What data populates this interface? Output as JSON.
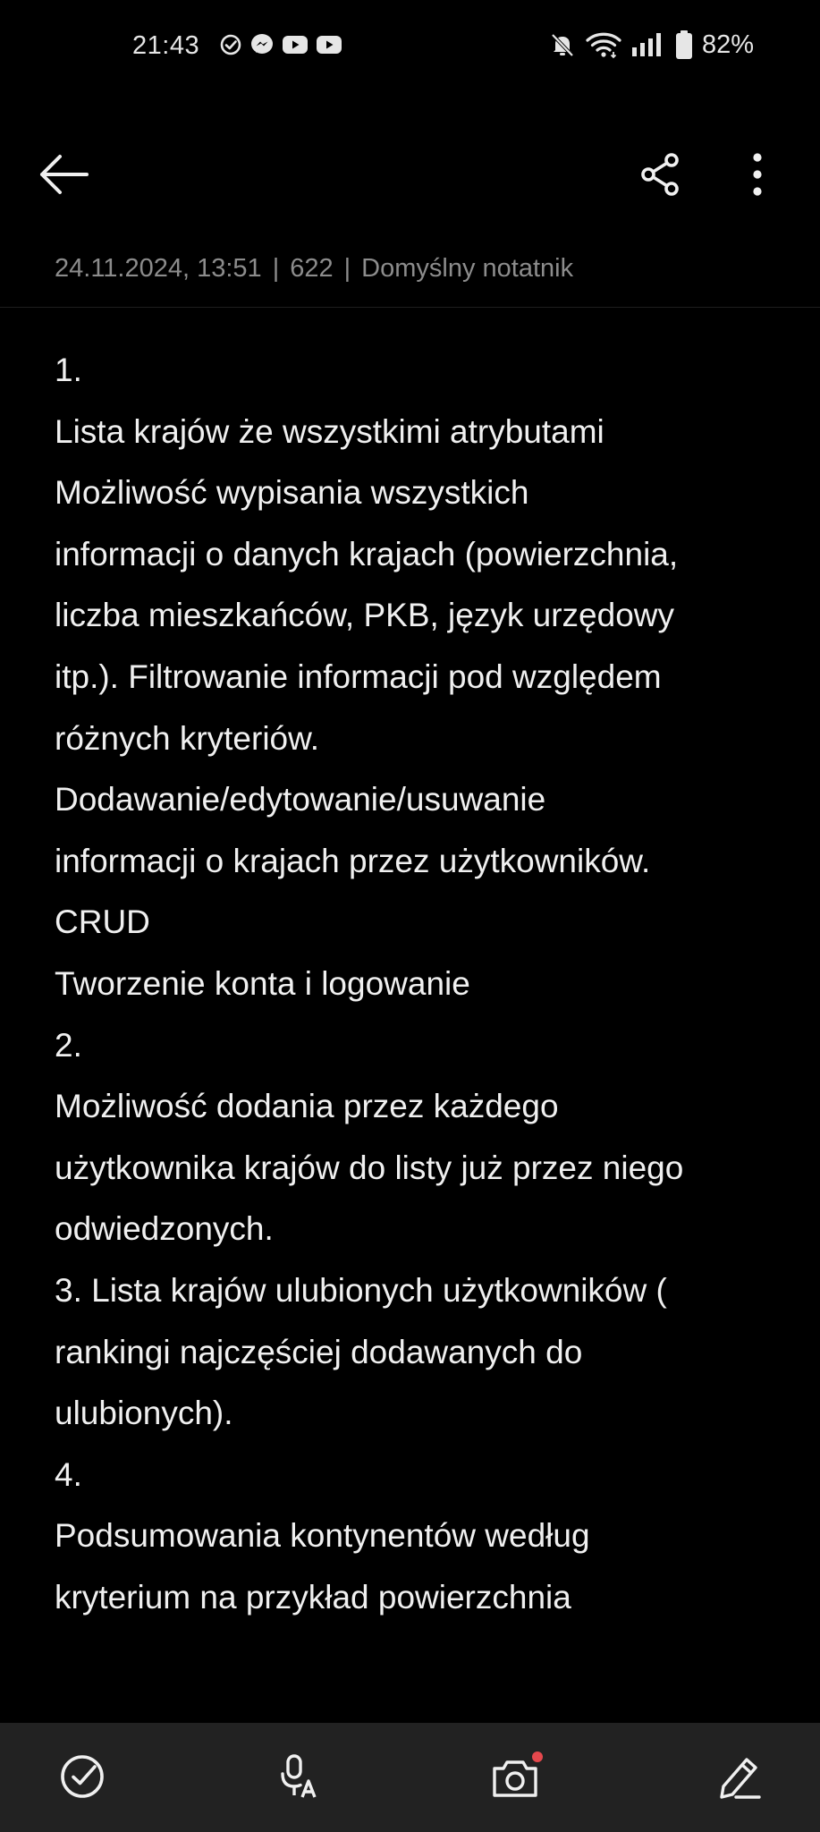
{
  "status_bar": {
    "time": "21:43",
    "left_icons": [
      "check-circle-icon",
      "messenger-icon",
      "youtube-icon",
      "youtube-icon"
    ],
    "right_icons": [
      "bell-muted-icon",
      "wifi-icon",
      "signal-icon",
      "battery-icon"
    ],
    "battery_percent": "82%"
  },
  "app_bar": {
    "back_icon": "arrow-left-icon",
    "share_icon": "share-icon",
    "more_icon": "more-vertical-icon"
  },
  "meta": {
    "date": "24.11.2024, 13:51",
    "separator": "|",
    "char_count": "622",
    "notebook": "Domyślny notatnik"
  },
  "note": {
    "lines": [
      "1.",
      "Lista krajów że wszystkimi atrybutami",
      "Możliwość wypisania wszystkich",
      "informacji o danych krajach (powierzchnia,",
      "liczba mieszkańców, PKB, język urzędowy",
      "itp.). Filtrowanie informacji pod względem",
      "różnych kryteriów.",
      "Dodawanie/edytowanie/usuwanie",
      "informacji o krajach przez użytkowników.",
      "CRUD",
      "Tworzenie konta i logowanie",
      "2.",
      "Możliwość dodania przez każdego",
      "użytkownika krajów do listy już przez niego",
      "odwiedzonych.",
      "3. Lista krajów ulubionych użytkowników (",
      "rankingi najczęściej dodawanych do",
      "ulubionych).",
      "4.",
      "Podsumowania kontynentów według",
      "kryterium na przykład powierzchnia"
    ]
  },
  "toolbar": {
    "items": [
      "checkbox-icon",
      "voice-to-text-icon",
      "camera-icon",
      "pen-icon"
    ]
  },
  "colors": {
    "background": "#000000",
    "text": "#f0f0f0",
    "meta_text": "#8c8c8c",
    "toolbar_bg": "#222222",
    "camera_badge": "#e5484d"
  }
}
